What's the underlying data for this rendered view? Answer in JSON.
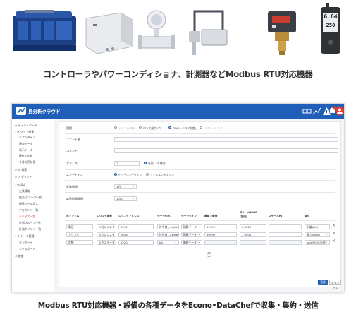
{
  "caption_top": "コントローラやパワーコンディショナ、計測器などModbus RTU対応機器",
  "caption_bottom": "Modbus RTU対応機器・設備の各種データをEcono•DataChefで収集・集約・送信",
  "devices": {
    "meter_display": {
      "line1": "6.64",
      "line2": "250"
    }
  },
  "app": {
    "title": "見分析クラウド",
    "accent": "#1f5fb8",
    "user_badge": "●"
  },
  "sidebar": {
    "items": [
      {
        "label": "≡ ダッシュボード"
      },
      {
        "label": "– ≡ グラフ結果"
      },
      {
        "label": "リアルタイム"
      },
      {
        "label": "過去データ"
      },
      {
        "label": "表示データ"
      },
      {
        "label": "現在の比較"
      },
      {
        "label": "今月の売結果"
      },
      {
        "label": "> ⚙ 帳票"
      },
      {
        "label": "> ↗ デマンド"
      },
      {
        "label": "– ⚙ 設定"
      },
      {
        "label": "企業情報"
      },
      {
        "label": "拠点/グループ一覧"
      },
      {
        "label": "帳票ルール設定"
      },
      {
        "label": "アカウント一覧"
      },
      {
        "label": "デバイス一覧"
      },
      {
        "label": "計測グループ一覧"
      },
      {
        "label": "計測ポイント一覧"
      },
      {
        "label": "– ⚙ データ管理"
      },
      {
        "label": "インポート"
      },
      {
        "label": "エクスポート"
      },
      {
        "label": "⚙ 設定"
      }
    ],
    "active_index": 14
  },
  "form": {
    "kind_label": "種類",
    "kind_options": [
      "デバイス本体",
      "RTU外部センサー",
      "RTU(レジスタ指定)",
      "リプレイシング"
    ],
    "kind_selected": 2,
    "unit_name_label": "ユニット名",
    "unit_name_value": "",
    "comment_label": "コメント",
    "comment_value": "",
    "address_label": "アドレス",
    "address_value": "1",
    "address_options": [
      "有効",
      "無効"
    ],
    "address_selected": 0,
    "endian_label": "エンディアン",
    "endian_options": [
      "ビッグエンディアン",
      "リトルエンディアン"
    ],
    "endian_selected": 0,
    "cycle_label": "収集周期",
    "cycle_value": "1分",
    "timeout_label": "応答時間間隔",
    "timeout_value": "1000"
  },
  "table": {
    "headers": [
      "ポイント名",
      "レジスタ種別",
      "レジスタアドレス",
      "データ形式",
      "データタイプ",
      "積算上限値",
      "スケールLOW (設定)",
      "スケールHI",
      "単位"
    ],
    "rows": [
      {
        "name": "電圧",
        "reg_type": "入力レジスタ",
        "address": "3010",
        "format": "符号無し4byte",
        "dtype": "積算データ",
        "limit": "99999",
        "scale_low": "0.0020",
        "scale_hi": "",
        "unit": "水量(L/h)"
      },
      {
        "name": "カウント",
        "reg_type": "入力レジスタ",
        "address": "2048",
        "format": "符号無し4byte",
        "dtype": "積算データ",
        "limit": "99999",
        "scale_low": "1.0000",
        "scale_hi": "",
        "unit": "電力(kWh)"
      },
      {
        "name": "状態",
        "reg_type": "入力ステータス",
        "address": "1220",
        "format": "bit",
        "dtype": "瞬時データ",
        "limit": "",
        "scale_low": "",
        "scale_hi": "",
        "unit": "on/off(ON/OFF)"
      }
    ]
  },
  "buttons": {
    "save": "登録",
    "cancel": "キャンセル"
  }
}
